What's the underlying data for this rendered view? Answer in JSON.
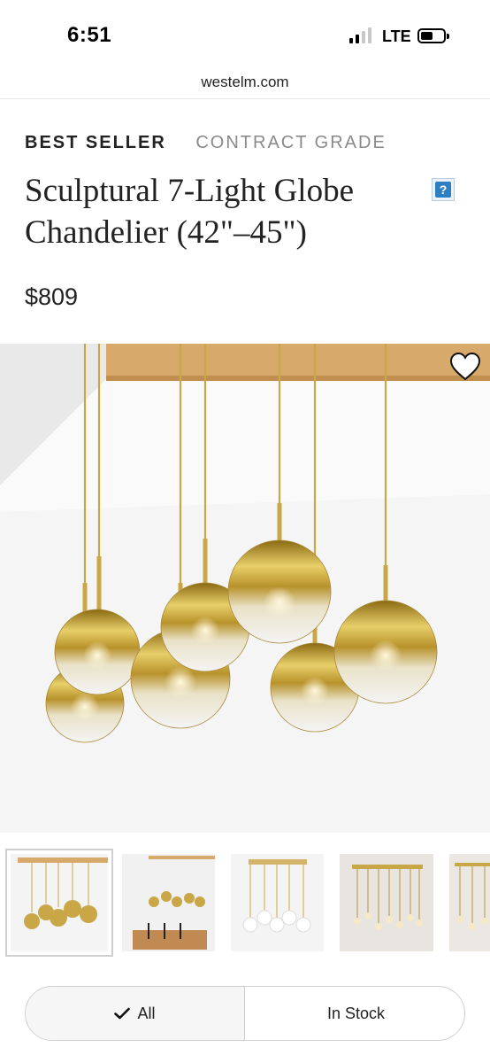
{
  "status": {
    "time": "6:51",
    "carrier": "LTE"
  },
  "browser": {
    "url": "westelm.com"
  },
  "product": {
    "badges": [
      "BEST SELLER",
      "CONTRACT GRADE"
    ],
    "title": "Sculptural 7-Light Globe Chandelier (42\"–45\")",
    "price": "$809",
    "help_icon": "?"
  },
  "gallery": {
    "images_count": 5,
    "selected_index": 0
  },
  "filters": {
    "options": [
      {
        "label": "All",
        "selected": true
      },
      {
        "label": "In Stock",
        "selected": false
      }
    ]
  },
  "colors": {
    "gold": "#c9a646",
    "wood": "#d7a96a",
    "help_blue": "#2e7fc1"
  },
  "icons": [
    "signal-icon",
    "battery-icon",
    "help-icon",
    "heart-icon",
    "check-icon"
  ]
}
